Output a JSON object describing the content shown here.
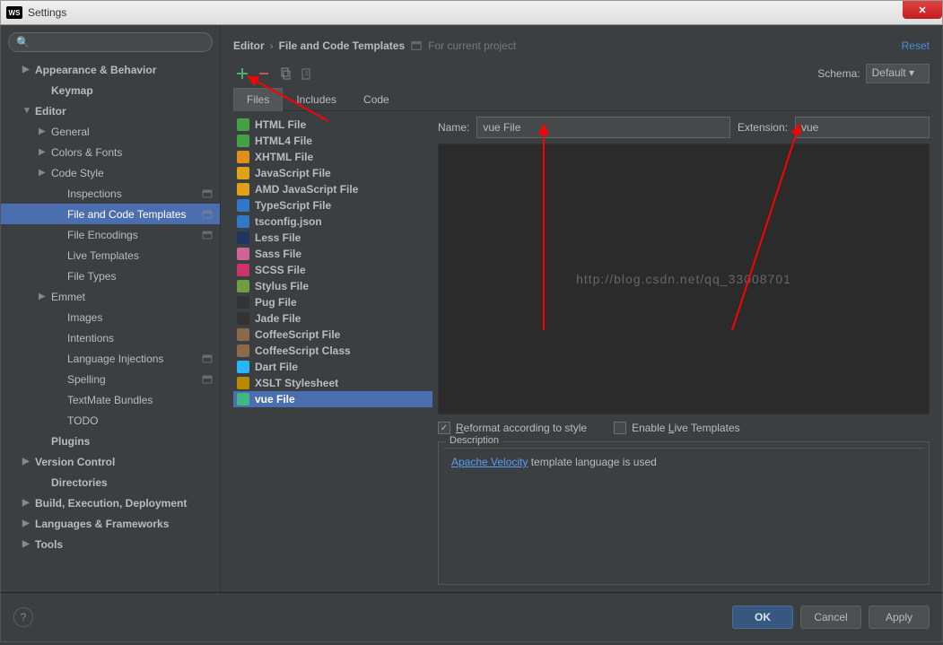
{
  "titlebar": {
    "badge": "WS",
    "title": "Settings",
    "close": "✕"
  },
  "search": {
    "placeholder": "",
    "icon": "🔍"
  },
  "tree": [
    {
      "label": "Appearance & Behavior",
      "indent": 0,
      "exp": "▶",
      "bold": true
    },
    {
      "label": "Keymap",
      "indent": 1,
      "exp": "",
      "bold": true
    },
    {
      "label": "Editor",
      "indent": 0,
      "exp": "▼",
      "bold": true
    },
    {
      "label": "General",
      "indent": 1,
      "exp": "▶",
      "bold": false
    },
    {
      "label": "Colors & Fonts",
      "indent": 1,
      "exp": "▶",
      "bold": false
    },
    {
      "label": "Code Style",
      "indent": 1,
      "exp": "▶",
      "bold": false
    },
    {
      "label": "Inspections",
      "indent": 2,
      "exp": "",
      "bold": false,
      "trail": true
    },
    {
      "label": "File and Code Templates",
      "indent": 2,
      "exp": "",
      "bold": false,
      "selected": true,
      "trail": true
    },
    {
      "label": "File Encodings",
      "indent": 2,
      "exp": "",
      "bold": false,
      "trail": true
    },
    {
      "label": "Live Templates",
      "indent": 2,
      "exp": "",
      "bold": false
    },
    {
      "label": "File Types",
      "indent": 2,
      "exp": "",
      "bold": false
    },
    {
      "label": "Emmet",
      "indent": 1,
      "exp": "▶",
      "bold": false
    },
    {
      "label": "Images",
      "indent": 2,
      "exp": "",
      "bold": false
    },
    {
      "label": "Intentions",
      "indent": 2,
      "exp": "",
      "bold": false
    },
    {
      "label": "Language Injections",
      "indent": 2,
      "exp": "",
      "bold": false,
      "trail": true
    },
    {
      "label": "Spelling",
      "indent": 2,
      "exp": "",
      "bold": false,
      "trail": true
    },
    {
      "label": "TextMate Bundles",
      "indent": 2,
      "exp": "",
      "bold": false
    },
    {
      "label": "TODO",
      "indent": 2,
      "exp": "",
      "bold": false
    },
    {
      "label": "Plugins",
      "indent": 1,
      "exp": "",
      "bold": true
    },
    {
      "label": "Version Control",
      "indent": 0,
      "exp": "▶",
      "bold": true
    },
    {
      "label": "Directories",
      "indent": 1,
      "exp": "",
      "bold": true
    },
    {
      "label": "Build, Execution, Deployment",
      "indent": 0,
      "exp": "▶",
      "bold": true
    },
    {
      "label": "Languages & Frameworks",
      "indent": 0,
      "exp": "▶",
      "bold": true
    },
    {
      "label": "Tools",
      "indent": 0,
      "exp": "▶",
      "bold": true
    }
  ],
  "breadcrumb": {
    "part1": "Editor",
    "sep": "›",
    "part2": "File and Code Templates",
    "scope": "For current project",
    "reset": "Reset"
  },
  "toolbar": {
    "schema_label": "Schema:",
    "schema_value": "Default ▾"
  },
  "tabs": [
    {
      "label": "Files",
      "active": true
    },
    {
      "label": "Includes",
      "active": false
    },
    {
      "label": "Code",
      "active": false
    }
  ],
  "templates": [
    {
      "label": "HTML File",
      "color": "#45a045"
    },
    {
      "label": "HTML4 File",
      "color": "#45a045"
    },
    {
      "label": "XHTML File",
      "color": "#e09018"
    },
    {
      "label": "JavaScript File",
      "color": "#e0a018"
    },
    {
      "label": "AMD JavaScript File",
      "color": "#e0a018"
    },
    {
      "label": "TypeScript File",
      "color": "#3178c6"
    },
    {
      "label": "tsconfig.json",
      "color": "#3178c6"
    },
    {
      "label": "Less File",
      "color": "#1d365d"
    },
    {
      "label": "Sass File",
      "color": "#cc6699"
    },
    {
      "label": "SCSS File",
      "color": "#cc3366"
    },
    {
      "label": "Stylus File",
      "color": "#6e9e3e"
    },
    {
      "label": "Pug File",
      "color": "#333333"
    },
    {
      "label": "Jade File",
      "color": "#333333"
    },
    {
      "label": "CoffeeScript File",
      "color": "#8a6a4a"
    },
    {
      "label": "CoffeeScript Class",
      "color": "#8a6a4a"
    },
    {
      "label": "Dart File",
      "color": "#29b6f6"
    },
    {
      "label": "XSLT Stylesheet",
      "color": "#b58900"
    },
    {
      "label": "vue File",
      "color": "#41b883",
      "selected": true
    }
  ],
  "fields": {
    "name_label": "Name:",
    "name_value": "vue File",
    "ext_label": "Extension:",
    "ext_value": "vue"
  },
  "options": {
    "reformat_pre": "R",
    "reformat_post": "eformat according to style",
    "live_pre": "Enable ",
    "live_u": "L",
    "live_post": "ive Templates"
  },
  "description": {
    "title": "Description",
    "link": "Apache Velocity",
    "rest": " template language is used"
  },
  "watermark": "http://blog.csdn.net/qq_33008701",
  "buttons": {
    "help": "?",
    "ok": "OK",
    "cancel": "Cancel",
    "apply": "Apply"
  }
}
